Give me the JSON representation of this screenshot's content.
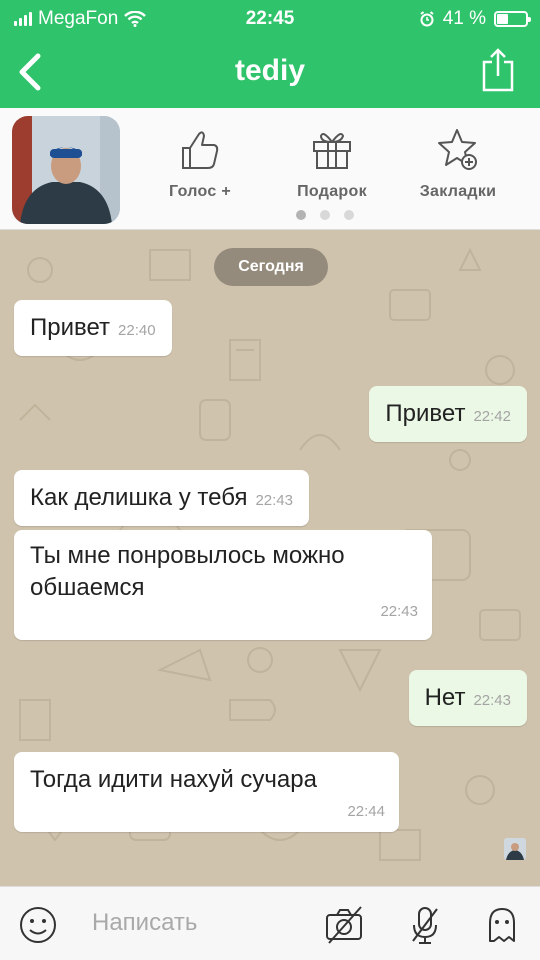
{
  "status_bar": {
    "carrier": "MegaFon",
    "time": "22:45",
    "battery_percent": "41 %",
    "battery_level": 0.41
  },
  "nav": {
    "title": "tediy"
  },
  "profile": {
    "actions": [
      {
        "label": "Голос +",
        "icon": "thumbs-up-icon"
      },
      {
        "label": "Подарок",
        "icon": "gift-icon"
      },
      {
        "label": "Закладки",
        "icon": "star-plus-icon"
      }
    ],
    "page_dots": 3,
    "active_dot": 0
  },
  "chat": {
    "date_label": "Сегодня",
    "messages": [
      {
        "direction": "in",
        "text": "Привет",
        "time": "22:40"
      },
      {
        "direction": "out",
        "text": "Привет",
        "time": "22:42"
      },
      {
        "direction": "in",
        "text": "Как делишка у тебя",
        "time": "22:43"
      },
      {
        "direction": "in",
        "text": "Ты мне понровылось можно обшаемся",
        "time": "22:43"
      },
      {
        "direction": "out",
        "text": "Нет",
        "time": "22:43"
      },
      {
        "direction": "in",
        "text": "Тогда идити нахуй сучара",
        "time": "22:44"
      }
    ]
  },
  "composer": {
    "placeholder": "Написать",
    "icons": [
      "emoji-icon",
      "camera-off-icon",
      "microphone-off-icon",
      "ghost-icon"
    ]
  },
  "colors": {
    "accent": "#2fc36b",
    "chat_background": "#cfc3ad",
    "outgoing_bubble": "#ebf8e6",
    "incoming_bubble": "#ffffff"
  }
}
